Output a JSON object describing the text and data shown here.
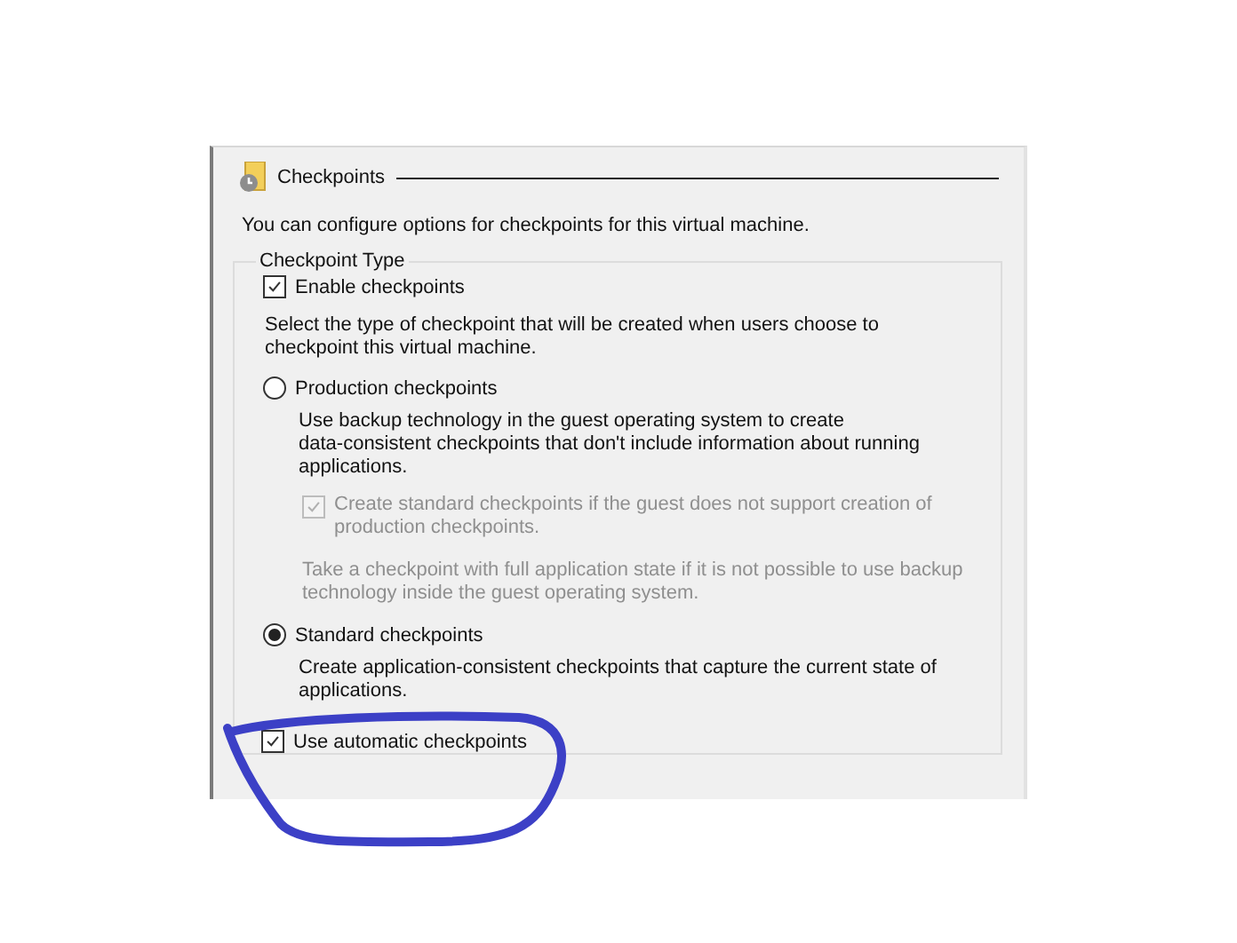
{
  "section": {
    "title": "Checkpoints"
  },
  "description": "You can configure options for checkpoints for this virtual machine.",
  "group": {
    "legend": "Checkpoint Type",
    "enable": {
      "label": "Enable checkpoints",
      "checked": true
    },
    "intro": "Select the type of checkpoint that will be created when users choose to\ncheckpoint this virtual machine.",
    "options": [
      {
        "label": "Production checkpoints",
        "selected": false,
        "description": "Use backup technology in the guest operating system to create\ndata-consistent checkpoints that don't include information about running\napplications.",
        "sub_option": {
          "label": "Create standard checkpoints if the guest does not support creation of\nproduction checkpoints.",
          "checked": true,
          "disabled": true
        },
        "note": "Take a checkpoint with full application state if it is not possible to use backup\ntechnology inside the guest operating system."
      },
      {
        "label": "Standard checkpoints",
        "selected": true,
        "description": "Create application-consistent checkpoints that capture the current state of\napplications."
      }
    ],
    "automatic": {
      "label": "Use automatic checkpoints",
      "checked": true
    }
  },
  "annotation": {
    "kind": "ellipse"
  }
}
